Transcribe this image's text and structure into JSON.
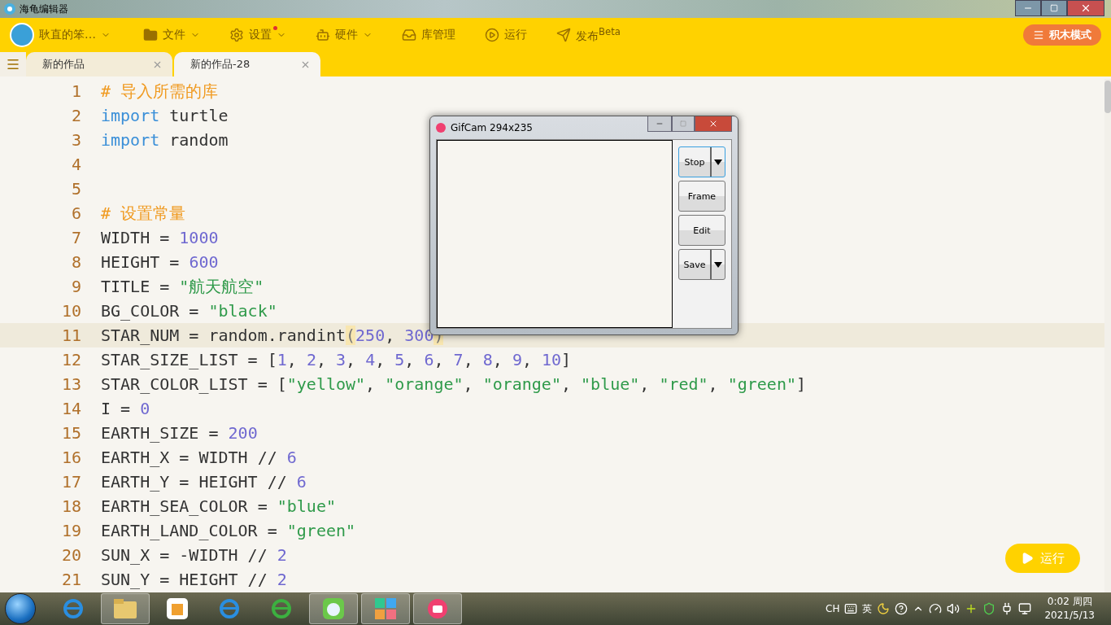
{
  "window": {
    "title": "海龟编辑器"
  },
  "toolbar": {
    "user": {
      "label": "耿直的笨…"
    },
    "menus": [
      {
        "kind": "file",
        "label": "文件",
        "dropdown": true,
        "notice": false
      },
      {
        "kind": "settings",
        "label": "设置",
        "dropdown": true,
        "notice": true
      },
      {
        "kind": "hardware",
        "label": "硬件",
        "dropdown": true,
        "notice": false
      },
      {
        "kind": "library",
        "label": "库管理",
        "dropdown": false,
        "notice": false
      },
      {
        "kind": "run",
        "label": "运行",
        "dropdown": false,
        "notice": false
      },
      {
        "kind": "publish",
        "label": "发布$^{Beta}$",
        "dropdown": false,
        "notice": false
      }
    ],
    "mode_button": "积木模式"
  },
  "tabs": [
    {
      "label": "新的作品",
      "selected": false
    },
    {
      "label": "新的作品-28",
      "selected": true
    }
  ],
  "editor": {
    "lines": [
      {
        "number": "1",
        "tokens": [
          {
            "kind": "comment",
            "text": "# 导入所需的库"
          }
        ]
      },
      {
        "number": "2",
        "tokens": [
          {
            "kind": "keyword",
            "text": "import"
          },
          {
            "kind": "plain",
            "text": " turtle"
          }
        ]
      },
      {
        "number": "3",
        "tokens": [
          {
            "kind": "keyword",
            "text": "import"
          },
          {
            "kind": "plain",
            "text": " random"
          }
        ]
      },
      {
        "number": "4"
      },
      {
        "number": "5"
      },
      {
        "number": "6",
        "tokens": [
          {
            "kind": "comment",
            "text": "# 设置常量"
          }
        ]
      },
      {
        "number": "7",
        "tokens": [
          {
            "kind": "plain",
            "text": "WIDTH = "
          },
          {
            "kind": "number",
            "text": "1000"
          }
        ]
      },
      {
        "number": "8",
        "tokens": [
          {
            "kind": "plain",
            "text": "HEIGHT = "
          },
          {
            "kind": "number",
            "text": "600"
          }
        ]
      },
      {
        "number": "9",
        "tokens": [
          {
            "kind": "plain",
            "text": "TITLE = "
          },
          {
            "kind": "string",
            "text": "\"航天航空\""
          }
        ]
      },
      {
        "number": "10",
        "tokens": [
          {
            "kind": "plain",
            "text": "BG_COLOR = "
          },
          {
            "kind": "string",
            "text": "\"black\""
          }
        ]
      },
      {
        "number": "11",
        "current": true,
        "tokens": [
          {
            "kind": "plain",
            "text": "STAR_NUM = random.randint"
          },
          {
            "kind": "bracket",
            "text": "("
          },
          {
            "kind": "number",
            "text": "250"
          },
          {
            "kind": "plain",
            "text": ", "
          },
          {
            "kind": "number",
            "text": "300"
          },
          {
            "kind": "bracket",
            "text": ")"
          }
        ]
      },
      {
        "number": "12",
        "tokens": [
          {
            "kind": "plain",
            "text": "STAR_SIZE_LIST = ["
          },
          {
            "kind": "number",
            "text": "1"
          },
          {
            "kind": "plain",
            "text": ", "
          },
          {
            "kind": "number",
            "text": "2"
          },
          {
            "kind": "plain",
            "text": ", "
          },
          {
            "kind": "number",
            "text": "3"
          },
          {
            "kind": "plain",
            "text": ", "
          },
          {
            "kind": "number",
            "text": "4"
          },
          {
            "kind": "plain",
            "text": ", "
          },
          {
            "kind": "number",
            "text": "5"
          },
          {
            "kind": "plain",
            "text": ", "
          },
          {
            "kind": "number",
            "text": "6"
          },
          {
            "kind": "plain",
            "text": ", "
          },
          {
            "kind": "number",
            "text": "7"
          },
          {
            "kind": "plain",
            "text": ", "
          },
          {
            "kind": "number",
            "text": "8"
          },
          {
            "kind": "plain",
            "text": ", "
          },
          {
            "kind": "number",
            "text": "9"
          },
          {
            "kind": "plain",
            "text": ", "
          },
          {
            "kind": "number",
            "text": "10"
          },
          {
            "kind": "plain",
            "text": "]"
          }
        ]
      },
      {
        "number": "13",
        "tokens": [
          {
            "kind": "plain",
            "text": "STAR_COLOR_LIST = ["
          },
          {
            "kind": "string",
            "text": "\"yellow\""
          },
          {
            "kind": "plain",
            "text": ", "
          },
          {
            "kind": "string",
            "text": "\"orange\""
          },
          {
            "kind": "plain",
            "text": ", "
          },
          {
            "kind": "string",
            "text": "\"orange\""
          },
          {
            "kind": "plain",
            "text": ", "
          },
          {
            "kind": "string",
            "text": "\"blue\""
          },
          {
            "kind": "plain",
            "text": ", "
          },
          {
            "kind": "string",
            "text": "\"red\""
          },
          {
            "kind": "plain",
            "text": ", "
          },
          {
            "kind": "string",
            "text": "\"green\""
          },
          {
            "kind": "plain",
            "text": "]"
          }
        ]
      },
      {
        "number": "14",
        "tokens": [
          {
            "kind": "plain",
            "text": "I = "
          },
          {
            "kind": "number",
            "text": "0"
          }
        ]
      },
      {
        "number": "15",
        "tokens": [
          {
            "kind": "plain",
            "text": "EARTH_SIZE = "
          },
          {
            "kind": "number",
            "text": "200"
          }
        ]
      },
      {
        "number": "16",
        "tokens": [
          {
            "kind": "plain",
            "text": "EARTH_X = WIDTH // "
          },
          {
            "kind": "number",
            "text": "6"
          }
        ]
      },
      {
        "number": "17",
        "tokens": [
          {
            "kind": "plain",
            "text": "EARTH_Y = HEIGHT // "
          },
          {
            "kind": "number",
            "text": "6"
          }
        ]
      },
      {
        "number": "18",
        "tokens": [
          {
            "kind": "plain",
            "text": "EARTH_SEA_COLOR = "
          },
          {
            "kind": "string",
            "text": "\"blue\""
          }
        ]
      },
      {
        "number": "19",
        "tokens": [
          {
            "kind": "plain",
            "text": "EARTH_LAND_COLOR = "
          },
          {
            "kind": "string",
            "text": "\"green\""
          }
        ]
      },
      {
        "number": "20",
        "tokens": [
          {
            "kind": "plain",
            "text": "SUN_X = -WIDTH // "
          },
          {
            "kind": "number",
            "text": "2"
          }
        ]
      },
      {
        "number": "21",
        "tokens": [
          {
            "kind": "plain",
            "text": "SUN_Y = HEIGHT // "
          },
          {
            "kind": "number",
            "text": "2"
          }
        ]
      }
    ]
  },
  "run_button": "运行",
  "gifcam": {
    "title": "GifCam 294x235",
    "buttons": [
      {
        "label": "Stop",
        "dropdown": true,
        "focused": true
      },
      {
        "label": "Frame",
        "dropdown": false,
        "focused": false
      },
      {
        "label": "Edit",
        "dropdown": false,
        "focused": false
      },
      {
        "label": "Save",
        "dropdown": true,
        "focused": false
      }
    ]
  },
  "taskbar": {
    "apps": [
      {
        "kind": "browser-e",
        "active": false
      },
      {
        "kind": "folder",
        "active": true
      },
      {
        "kind": "box",
        "active": false
      },
      {
        "kind": "browser-e",
        "active": false
      },
      {
        "kind": "browser-green",
        "active": false
      },
      {
        "kind": "turtle",
        "active": true
      },
      {
        "kind": "tiles",
        "active": true
      },
      {
        "kind": "camera",
        "active": true
      }
    ],
    "language": "CH",
    "ime": "英",
    "time": "0:02 周四",
    "date": "2021/5/13"
  }
}
